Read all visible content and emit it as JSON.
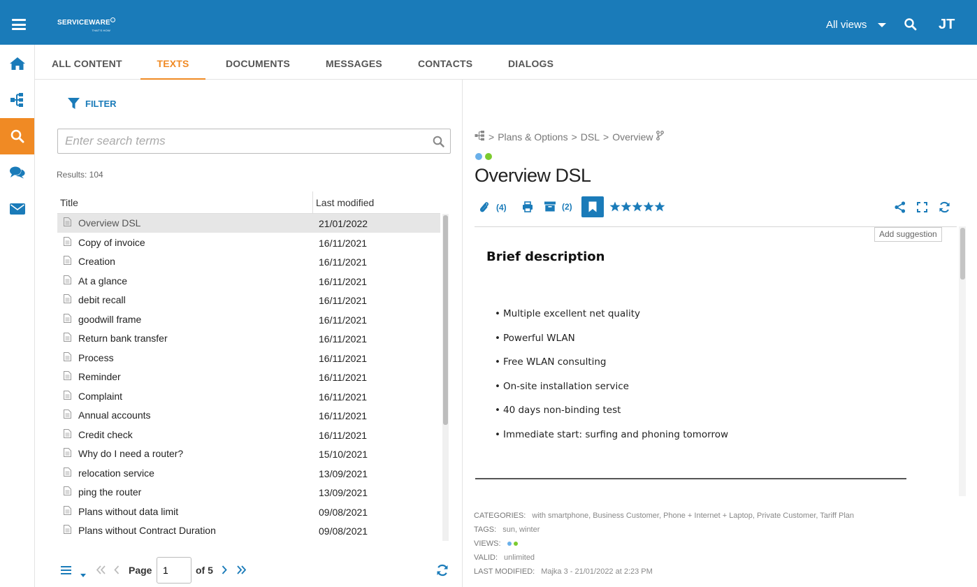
{
  "app": {
    "logo_text": "SERVICEWARE",
    "logo_tagline": "THAT'S HOW",
    "views_label": "All views",
    "user_initials": "JT"
  },
  "colors": {
    "brand": "#1a7bb9",
    "accent": "#f08a24",
    "view_dot_1": "#6ab0ea",
    "view_dot_2": "#7ccb2f"
  },
  "nav": [
    {
      "icon": "home-icon"
    },
    {
      "icon": "structure-icon"
    },
    {
      "icon": "search-icon",
      "active": true
    },
    {
      "icon": "chat-icon"
    },
    {
      "icon": "mail-icon"
    }
  ],
  "tabs": [
    {
      "label": "ALL CONTENT"
    },
    {
      "label": "TEXTS",
      "active": true
    },
    {
      "label": "DOCUMENTS"
    },
    {
      "label": "MESSAGES"
    },
    {
      "label": "CONTACTS"
    },
    {
      "label": "DIALOGS"
    }
  ],
  "filter_label": "FILTER",
  "search": {
    "placeholder": "Enter search terms",
    "value": ""
  },
  "results_label": "Results: 104",
  "table": {
    "columns": [
      "Title",
      "Last modified"
    ],
    "rows": [
      {
        "title": "Overview DSL",
        "date": "21/01/2022",
        "selected": true
      },
      {
        "title": "Copy of invoice",
        "date": "16/11/2021"
      },
      {
        "title": "Creation",
        "date": "16/11/2021"
      },
      {
        "title": "At a glance",
        "date": "16/11/2021"
      },
      {
        "title": "debit recall",
        "date": "16/11/2021"
      },
      {
        "title": "goodwill frame",
        "date": "16/11/2021"
      },
      {
        "title": "Return bank transfer",
        "date": "16/11/2021"
      },
      {
        "title": "Process",
        "date": "16/11/2021"
      },
      {
        "title": "Reminder",
        "date": "16/11/2021"
      },
      {
        "title": "Complaint",
        "date": "16/11/2021"
      },
      {
        "title": "Annual accounts",
        "date": "16/11/2021"
      },
      {
        "title": "Credit check",
        "date": "16/11/2021"
      },
      {
        "title": "Why do I need a router?",
        "date": "15/10/2021"
      },
      {
        "title": "relocation service",
        "date": "13/09/2021"
      },
      {
        "title": "ping the router",
        "date": "13/09/2021"
      },
      {
        "title": "Plans without data limit",
        "date": "09/08/2021"
      },
      {
        "title": "Plans without Contract Duration",
        "date": "09/08/2021"
      }
    ]
  },
  "pager": {
    "page_label": "Page",
    "page_value": "1",
    "of_label": "of 5"
  },
  "detail": {
    "breadcrumb": [
      "Plans & Options",
      "DSL",
      "Overview"
    ],
    "breadcrumb_sep": ">",
    "title": "Overview DSL",
    "attachments_count": "(4)",
    "archive_count": "(2)",
    "rating": 5,
    "add_suggestion": "Add suggestion",
    "heading": "Brief description",
    "bullets": [
      "Multiple excellent net quality",
      "Powerful WLAN",
      "Free WLAN consulting",
      "On-site installation service",
      "40 days non-binding test",
      "Immediate start: surfing and phoning tomorrow"
    ],
    "meta": {
      "categories_key": "CATEGORIES:",
      "categories": "with smartphone, Business Customer, Phone + Internet + Laptop, Private Customer, Tariff Plan",
      "tags_key": "TAGS:",
      "tags": "sun, winter",
      "views_key": "VIEWS:",
      "valid_key": "VALID:",
      "valid": "unlimited",
      "modified_key": "LAST MODIFIED:",
      "modified": "Majka 3 - 21/01/2022 at 2:23 PM"
    }
  }
}
